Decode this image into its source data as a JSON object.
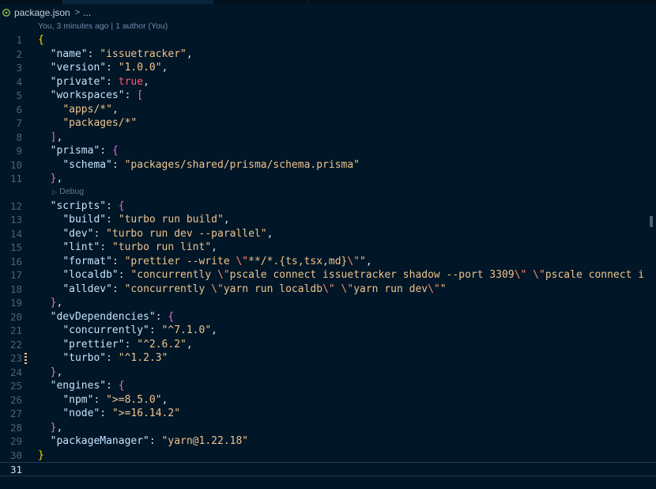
{
  "breadcrumb": {
    "file": "package.json",
    "separator": ">",
    "more": "..."
  },
  "blame": "You, 3 minutes ago | 1 author (You)",
  "codelens": {
    "label": "Debug",
    "icon": "play-icon"
  },
  "icons": {
    "file": "json-file-icon",
    "chevron": "chevron-right-icon"
  },
  "colors": {
    "background": "#011627",
    "string": "#ecc48d",
    "key": "#c5e4fd",
    "boolean": "#ff5874",
    "brace_level1": "#ffd700",
    "brace_level2": "#da70d6",
    "brace_level3": "#179fff"
  },
  "editor": {
    "current_line": 31,
    "lines": [
      {
        "n": "1",
        "tokens": [
          [
            "{",
            "brace1"
          ]
        ]
      },
      {
        "n": "2",
        "tokens": [
          [
            "  ",
            ""
          ],
          [
            "\"name\"",
            "key"
          ],
          [
            ": ",
            "punc"
          ],
          [
            "\"issuetracker\"",
            "str"
          ],
          [
            ",",
            "punc"
          ]
        ]
      },
      {
        "n": "3",
        "tokens": [
          [
            "  ",
            ""
          ],
          [
            "\"version\"",
            "key"
          ],
          [
            ": ",
            "punc"
          ],
          [
            "\"1.0.0\"",
            "str"
          ],
          [
            ",",
            "punc"
          ]
        ]
      },
      {
        "n": "4",
        "tokens": [
          [
            "  ",
            ""
          ],
          [
            "\"private\"",
            "key"
          ],
          [
            ": ",
            "punc"
          ],
          [
            "true",
            "bool"
          ],
          [
            ",",
            "punc"
          ]
        ]
      },
      {
        "n": "5",
        "tokens": [
          [
            "  ",
            ""
          ],
          [
            "\"workspaces\"",
            "key"
          ],
          [
            ": ",
            "punc"
          ],
          [
            "[",
            "brace2"
          ]
        ]
      },
      {
        "n": "6",
        "tokens": [
          [
            "    ",
            ""
          ],
          [
            "\"apps/*\"",
            "str"
          ],
          [
            ",",
            "punc"
          ]
        ]
      },
      {
        "n": "7",
        "tokens": [
          [
            "    ",
            ""
          ],
          [
            "\"packages/*\"",
            "str"
          ]
        ]
      },
      {
        "n": "8",
        "tokens": [
          [
            "  ",
            ""
          ],
          [
            "]",
            "brace2"
          ],
          [
            ",",
            "punc"
          ]
        ]
      },
      {
        "n": "9",
        "tokens": [
          [
            "  ",
            ""
          ],
          [
            "\"prisma\"",
            "key"
          ],
          [
            ": ",
            "punc"
          ],
          [
            "{",
            "brace2"
          ]
        ]
      },
      {
        "n": "10",
        "tokens": [
          [
            "    ",
            ""
          ],
          [
            "\"schema\"",
            "key"
          ],
          [
            ": ",
            "punc"
          ],
          [
            "\"packages/shared/prisma/schema.prisma\"",
            "str"
          ]
        ]
      },
      {
        "n": "11",
        "tokens": [
          [
            "  ",
            ""
          ],
          [
            "}",
            "brace2"
          ],
          [
            ",",
            "punc"
          ]
        ]
      },
      {
        "n": "12",
        "tokens": [
          [
            "  ",
            ""
          ],
          [
            "\"scripts\"",
            "key"
          ],
          [
            ": ",
            "punc"
          ],
          [
            "{",
            "brace2"
          ]
        ]
      },
      {
        "n": "13",
        "tokens": [
          [
            "    ",
            ""
          ],
          [
            "\"build\"",
            "key"
          ],
          [
            ": ",
            "punc"
          ],
          [
            "\"turbo run build\"",
            "str"
          ],
          [
            ",",
            "punc"
          ]
        ]
      },
      {
        "n": "14",
        "tokens": [
          [
            "    ",
            ""
          ],
          [
            "\"dev\"",
            "key"
          ],
          [
            ": ",
            "punc"
          ],
          [
            "\"turbo run dev --parallel\"",
            "str"
          ],
          [
            ",",
            "punc"
          ]
        ]
      },
      {
        "n": "15",
        "tokens": [
          [
            "    ",
            ""
          ],
          [
            "\"lint\"",
            "key"
          ],
          [
            ": ",
            "punc"
          ],
          [
            "\"turbo run lint\"",
            "str"
          ],
          [
            ",",
            "punc"
          ]
        ]
      },
      {
        "n": "16",
        "tokens": [
          [
            "    ",
            ""
          ],
          [
            "\"format\"",
            "key"
          ],
          [
            ": ",
            "punc"
          ],
          [
            "\"prettier --write ",
            "str"
          ],
          [
            "\\\"",
            "esc"
          ],
          [
            "**/*.{ts,tsx,md}",
            "str"
          ],
          [
            "\\\"",
            "esc"
          ],
          [
            "\"",
            "str"
          ],
          [
            ",",
            "punc"
          ]
        ]
      },
      {
        "n": "17",
        "tokens": [
          [
            "    ",
            ""
          ],
          [
            "\"localdb\"",
            "key"
          ],
          [
            ": ",
            "punc"
          ],
          [
            "\"concurrently ",
            "str"
          ],
          [
            "\\\"",
            "esc"
          ],
          [
            "pscale connect issuetracker shadow --port 3309",
            "str"
          ],
          [
            "\\\"",
            "esc"
          ],
          [
            " ",
            "str"
          ],
          [
            "\\\"",
            "esc"
          ],
          [
            "pscale connect i",
            "str"
          ]
        ]
      },
      {
        "n": "18",
        "tokens": [
          [
            "    ",
            ""
          ],
          [
            "\"alldev\"",
            "key"
          ],
          [
            ": ",
            "punc"
          ],
          [
            "\"concurrently ",
            "str"
          ],
          [
            "\\\"",
            "esc"
          ],
          [
            "yarn run localdb",
            "str"
          ],
          [
            "\\\"",
            "esc"
          ],
          [
            " ",
            "str"
          ],
          [
            "\\\"",
            "esc"
          ],
          [
            "yarn run dev",
            "str"
          ],
          [
            "\\\"",
            "esc"
          ],
          [
            "\"",
            "str"
          ]
        ]
      },
      {
        "n": "19",
        "tokens": [
          [
            "  ",
            ""
          ],
          [
            "}",
            "brace2"
          ],
          [
            ",",
            "punc"
          ]
        ]
      },
      {
        "n": "20",
        "tokens": [
          [
            "  ",
            ""
          ],
          [
            "\"devDependencies\"",
            "key"
          ],
          [
            ": ",
            "punc"
          ],
          [
            "{",
            "brace2"
          ]
        ]
      },
      {
        "n": "21",
        "tokens": [
          [
            "    ",
            ""
          ],
          [
            "\"concurrently\"",
            "key"
          ],
          [
            ": ",
            "punc"
          ],
          [
            "\"^7.1.0\"",
            "str"
          ],
          [
            ",",
            "punc"
          ]
        ]
      },
      {
        "n": "22",
        "tokens": [
          [
            "    ",
            ""
          ],
          [
            "\"prettier\"",
            "key"
          ],
          [
            ": ",
            "punc"
          ],
          [
            "\"^2.6.2\"",
            "str"
          ],
          [
            ",",
            "punc"
          ]
        ]
      },
      {
        "n": "23",
        "tokens": [
          [
            "    ",
            ""
          ],
          [
            "\"turbo\"",
            "key"
          ],
          [
            ": ",
            "punc"
          ],
          [
            "\"^1.2.3\"",
            "str"
          ]
        ]
      },
      {
        "n": "24",
        "tokens": [
          [
            "  ",
            ""
          ],
          [
            "}",
            "brace2"
          ],
          [
            ",",
            "punc"
          ]
        ]
      },
      {
        "n": "25",
        "tokens": [
          [
            "  ",
            ""
          ],
          [
            "\"engines\"",
            "key"
          ],
          [
            ": ",
            "punc"
          ],
          [
            "{",
            "brace2"
          ]
        ]
      },
      {
        "n": "26",
        "tokens": [
          [
            "    ",
            ""
          ],
          [
            "\"npm\"",
            "key"
          ],
          [
            ": ",
            "punc"
          ],
          [
            "\">=8.5.0\"",
            "str"
          ],
          [
            ",",
            "punc"
          ]
        ]
      },
      {
        "n": "27",
        "tokens": [
          [
            "    ",
            ""
          ],
          [
            "\"node\"",
            "key"
          ],
          [
            ": ",
            "punc"
          ],
          [
            "\">=16.14.2\"",
            "str"
          ]
        ]
      },
      {
        "n": "28",
        "tokens": [
          [
            "  ",
            ""
          ],
          [
            "}",
            "brace2"
          ],
          [
            ",",
            "punc"
          ]
        ]
      },
      {
        "n": "29",
        "tokens": [
          [
            "  ",
            ""
          ],
          [
            "\"packageManager\"",
            "key"
          ],
          [
            ": ",
            "punc"
          ],
          [
            "\"yarn@1.22.18\"",
            "str"
          ]
        ]
      },
      {
        "n": "30",
        "tokens": [
          [
            "}",
            "brace1"
          ]
        ]
      },
      {
        "n": "31",
        "tokens": []
      }
    ]
  }
}
